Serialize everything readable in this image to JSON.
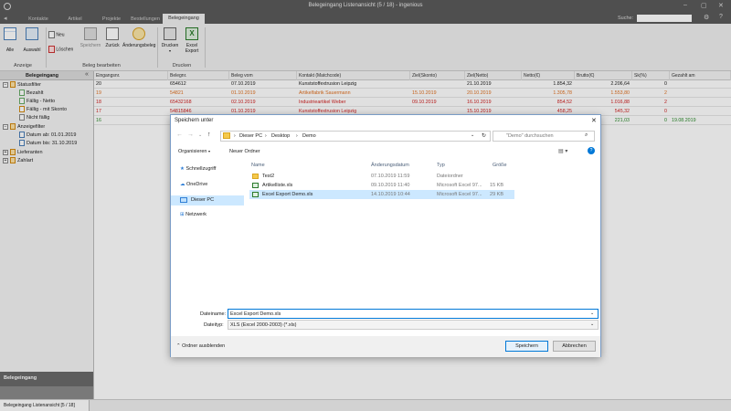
{
  "app": {
    "title": "Belegeingang Listenansicht (5 / 18) - ingenious",
    "menu_tabs": [
      "Kontakte",
      "Artikel",
      "Projekte",
      "Bestellungen",
      "Belegeingang"
    ],
    "search_label": "Suche:"
  },
  "ribbon": {
    "buttons": {
      "alle": "Alle",
      "auswahl": "Auswahl",
      "neu": "Neu",
      "loeschen": "Löschen",
      "speichern": "Speichern",
      "zurueck": "Zurück",
      "aenderungsbeleg": "Änderungsbeleg",
      "drucken": "Drucken",
      "excel_export": "Excel Export"
    },
    "groups": {
      "anzeige": "Anzeige",
      "beleg_bearbeiten": "Beleg bearbeiten",
      "drucken": "Drucken"
    }
  },
  "left_panel": {
    "header": "Belegeingang",
    "tree": {
      "statusfilter": "Statusfilter",
      "bezahlt": "Bezahlt",
      "faellig_netto": "Fällig - Netto",
      "faellig_skonto": "Fällig - mit Skonto",
      "nicht_faellig": "Nicht fällig",
      "anzeigefilter": "Anzeigefilter",
      "datum_ab": "Datum ab: 01.01.2019",
      "datum_bis": "Datum bis: 31.10.2019",
      "lieferanten": "Lieferanten",
      "zahlart": "Zahlart"
    },
    "footer_header": "Belegeingang"
  },
  "grid": {
    "columns": [
      "Eingangsnr.",
      "Belegnr.",
      "Beleg vom",
      "Kontakt (Matchcode)",
      "Ziel(Skonto)",
      "Ziel(Netto)",
      "Netto(€)",
      "Brutto(€)",
      "Sk(%)",
      "Gezahlt am"
    ],
    "rows": [
      {
        "nr": "20",
        "beleg": "654612",
        "vom": "07.10.2019",
        "kontakt": "Kunststoffextrusion Leipzig",
        "skonto": "",
        "netto_ziel": "21.10.2019",
        "netto": "1.854,32",
        "brutto": "2.206,64",
        "sk": "0",
        "gezahlt": "",
        "status": "normal"
      },
      {
        "nr": "19",
        "beleg": "54821",
        "vom": "01.10.2019",
        "kontakt": "Artikelfabrik Sauermann",
        "skonto": "15.10.2019",
        "netto_ziel": "20.10.2019",
        "netto": "1.305,78",
        "brutto": "1.553,80",
        "sk": "2",
        "gezahlt": "",
        "status": "orange"
      },
      {
        "nr": "18",
        "beleg": "65432168",
        "vom": "02.10.2019",
        "kontakt": "Industrieartikel Weber",
        "skonto": "09.10.2019",
        "netto_ziel": "16.10.2019",
        "netto": "854,52",
        "brutto": "1.016,88",
        "sk": "2",
        "gezahlt": "",
        "status": "red"
      },
      {
        "nr": "17",
        "beleg": "54815846",
        "vom": "01.10.2019",
        "kontakt": "Kunststoffextrusion Leipzig",
        "skonto": "",
        "netto_ziel": "15.10.2019",
        "netto": "458,25",
        "brutto": "545,32",
        "sk": "0",
        "gezahlt": "",
        "status": "red"
      },
      {
        "nr": "16",
        "beleg": "",
        "vom": "",
        "kontakt": "",
        "skonto": "",
        "netto_ziel": "",
        "netto": "",
        "brutto": "221,03",
        "sk": "0",
        "gezahlt": "19.08.2019",
        "status": "green"
      }
    ]
  },
  "status_bar": {
    "tab": "Belegeingang Listenansicht [5 / 18]"
  },
  "dialog": {
    "title": "Speichern unter",
    "breadcrumb": [
      "Dieser PC",
      "Desktop",
      "Demo"
    ],
    "search_placeholder": "\"Demo\" durchsuchen",
    "toolbar": {
      "organisieren": "Organisieren",
      "neuer_ordner": "Neuer Ordner"
    },
    "nav": [
      "Schnellzugriff",
      "OneDrive",
      "Dieser PC",
      "Netzwerk"
    ],
    "columns": [
      "Name",
      "Änderungsdatum",
      "Typ",
      "Größe"
    ],
    "files": [
      {
        "name": "Test2",
        "date": "07.10.2019 11:59",
        "type": "Dateiordner",
        "size": "",
        "kind": "folder"
      },
      {
        "name": "Artikelliste.xls",
        "date": "09.10.2019 11:40",
        "type": "Microsoft Excel 97...",
        "size": "15 KB",
        "kind": "excel"
      },
      {
        "name": "Excel Export Demo.xls",
        "date": "14.10.2019 10:44",
        "type": "Microsoft Excel 97...",
        "size": "29 KB",
        "kind": "excel"
      }
    ],
    "filename_label": "Dateiname:",
    "filename_value": "Excel Export Demo.xls",
    "filetype_label": "Dateityp:",
    "filetype_value": "XLS (Excel 2000-2003) (*.xls)",
    "hide_folders": "Ordner ausblenden",
    "save_button": "Speichern",
    "cancel_button": "Abbrechen"
  },
  "colors": {
    "orange": "#e07020",
    "red": "#d02020",
    "green": "#2a8a2a",
    "selection": "#cce8ff",
    "accent": "#0078d7"
  }
}
